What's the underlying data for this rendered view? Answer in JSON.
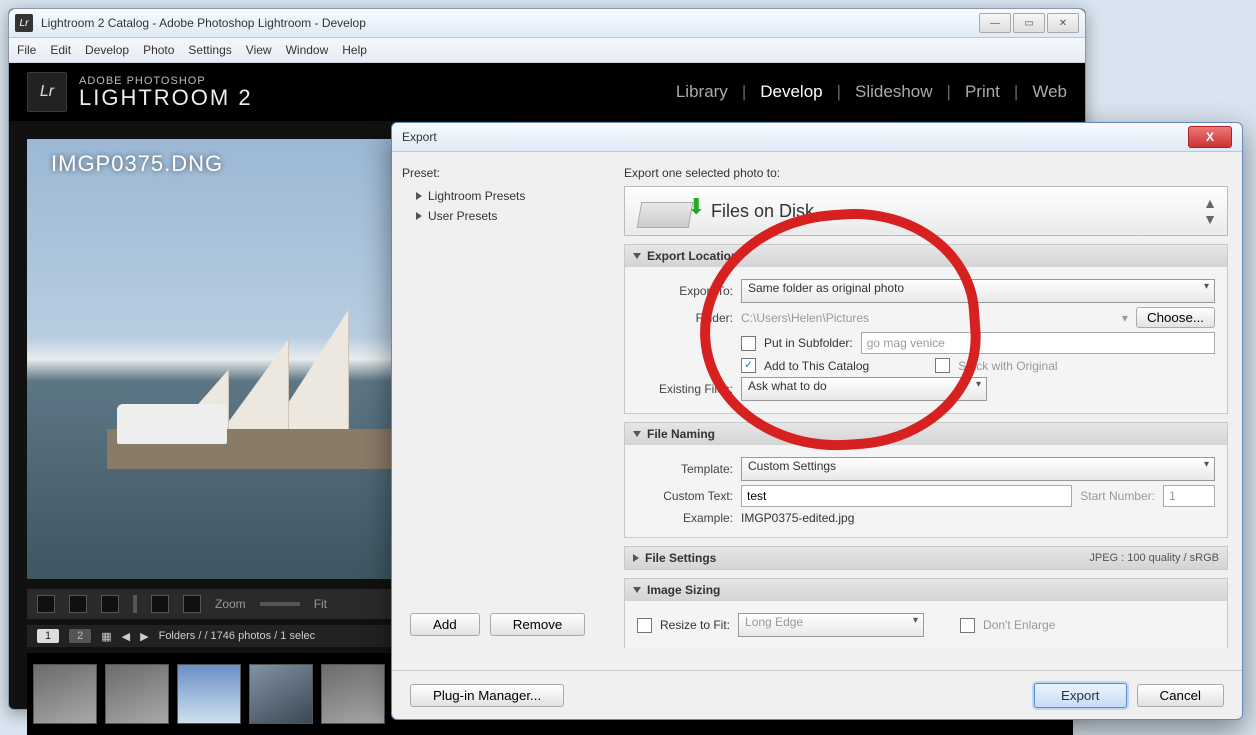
{
  "window": {
    "title": "Lightroom 2 Catalog - Adobe Photoshop Lightroom - Develop",
    "app_icon": "Lr"
  },
  "menubar": [
    "File",
    "Edit",
    "Develop",
    "Photo",
    "Settings",
    "View",
    "Window",
    "Help"
  ],
  "brand": {
    "small": "ADOBE PHOTOSHOP",
    "big": "LIGHTROOM 2",
    "logo": "Lr"
  },
  "modules": [
    "Library",
    "Develop",
    "Slideshow",
    "Print",
    "Web"
  ],
  "active_module": "Develop",
  "photo": {
    "filename": "IMGP0375.DNG"
  },
  "strip": {
    "zoom": "Zoom",
    "fit": "Fit"
  },
  "status": {
    "page1": "1",
    "page2": "2",
    "text": "Folders /  / 1746 photos / 1 selec"
  },
  "dialog": {
    "title": "Export",
    "preset_label": "Preset:",
    "presets": [
      "Lightroom Presets",
      "User Presets"
    ],
    "add": "Add",
    "remove": "Remove",
    "plugin": "Plug-in Manager...",
    "subtitle": "Export one selected photo to:",
    "destination": "Files on Disk",
    "close": "X",
    "sections": {
      "export_location": {
        "title": "Export Location",
        "export_to_label": "Export To:",
        "export_to": "Same folder as original photo",
        "folder_label": "Folder:",
        "folder": "C:\\Users\\Helen\\Pictures",
        "choose": "Choose...",
        "subfolder_label": "Put in Subfolder:",
        "subfolder_value": "go mag venice",
        "add_catalog": "Add to This Catalog",
        "stack": "Stack with Original",
        "existing_label": "Existing Files:",
        "existing": "Ask what to do"
      },
      "file_naming": {
        "title": "File Naming",
        "template_label": "Template:",
        "template": "Custom Settings",
        "custom_text_label": "Custom Text:",
        "custom_text": "test",
        "start_label": "Start Number:",
        "start": "1",
        "example_label": "Example:",
        "example": "IMGP0375-edited.jpg"
      },
      "file_settings": {
        "title": "File Settings",
        "summary": "JPEG : 100 quality / sRGB"
      },
      "image_sizing": {
        "title": "Image Sizing",
        "resize_label": "Resize to Fit:",
        "resize_value": "Long Edge",
        "no_enlarge": "Don't Enlarge"
      }
    },
    "export_btn": "Export",
    "cancel_btn": "Cancel"
  }
}
